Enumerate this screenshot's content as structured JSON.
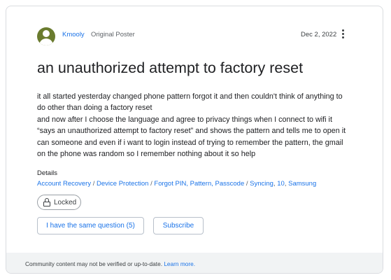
{
  "post": {
    "username": "Kmooly",
    "role": "Original Poster",
    "date": "Dec 2, 2022",
    "title": "an unauthorized attempt to factory reset",
    "body_lines": [
      "it all started yesterday changed phone pattern forgot it and then couldn't think of anything to",
      "do other than doing a factory reset",
      "and now after I choose the language and agree to privacy things when I connect to wifi it",
      "“says an unauthorized attempt to factory reset” and shows the pattern and tells me to open it",
      "can someone and even if i want to login instead of trying to remember the pattern, the gmail",
      "on the phone was random so I remember nothing about it so help"
    ]
  },
  "details": {
    "label": "Details",
    "tags": [
      "Account Recovery",
      "Device Protection",
      "Forgot PIN, Pattern, Passcode",
      "Syncing",
      "10",
      "Samsung"
    ],
    "separators": [
      " / ",
      " / ",
      " / ",
      ", ",
      ", "
    ]
  },
  "status": {
    "locked_label": "Locked"
  },
  "actions": {
    "same_question_label": "I have the same question (5)",
    "subscribe_label": "Subscribe"
  },
  "footer": {
    "text": "Community content may not be verified or up-to-date.",
    "link": "Learn more."
  },
  "icons": {
    "avatar": "account-circle-icon",
    "menu": "more-vert-icon",
    "lock": "lock-icon"
  },
  "colors": {
    "accent": "#1a73e8",
    "avatar_bg": "#6a7b2e",
    "footer_bg": "#f1f3f4"
  }
}
